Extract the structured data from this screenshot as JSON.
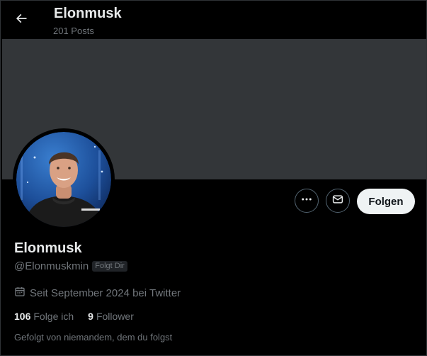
{
  "header": {
    "title": "Elonmusk",
    "posts_count": "201 Posts",
    "back_icon": "arrow-left-icon"
  },
  "profile": {
    "display_name": "Elonmusk",
    "handle": "@Elonmuskmin",
    "follows_you_badge": "Folgt Dir",
    "joined": "Seit September 2024 bei Twitter",
    "following_count": "106",
    "following_label": "Folge ich",
    "followers_count": "9",
    "followers_label": "Follower",
    "followed_by_text": "Gefolgt von niemandem, dem du folgst"
  },
  "actions": {
    "more_icon": "more-dots-icon",
    "message_icon": "envelope-icon",
    "follow_label": "Folgen"
  },
  "colors": {
    "background": "#000000",
    "banner": "#333639",
    "text_primary": "#e7e9ea",
    "text_secondary": "#71767b",
    "button_light": "#eff3f4"
  }
}
